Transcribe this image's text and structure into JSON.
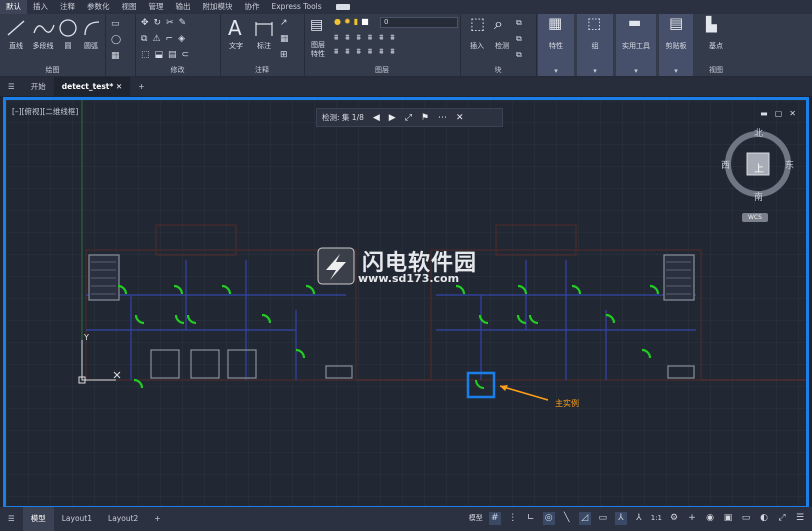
{
  "menu_tabs": [
    "默认",
    "插入",
    "注释",
    "参数化",
    "视图",
    "管理",
    "输出",
    "附加模块",
    "协作",
    "Express Tools"
  ],
  "ribbon": {
    "draw": {
      "label": "绘图",
      "tools": [
        "直线",
        "多段线",
        "圆",
        "圆弧"
      ]
    },
    "modify": {
      "label": "修改"
    },
    "annotation": {
      "label": "注释",
      "tools": [
        "文字",
        "标注"
      ]
    },
    "layers": {
      "label": "图层",
      "layer_properties": "图层\n特性",
      "current_layer": "0"
    },
    "block": {
      "label": "块",
      "tools": [
        "插入",
        "检测"
      ]
    },
    "properties": {
      "label": "特性"
    },
    "groups": {
      "label": "组"
    },
    "utilities": {
      "label": "实用工具"
    },
    "clipboard": {
      "label": "剪贴板"
    },
    "view": {
      "label": "视图",
      "base": "基点"
    }
  },
  "doc_tabs": {
    "start": "开始",
    "current": "detect_test*"
  },
  "viewport": {
    "label": "[–][俯视][二维线框]"
  },
  "detect_toolbar": {
    "text": "检测: 集 1/8"
  },
  "viewcube": {
    "north": "北",
    "south": "南",
    "east": "东",
    "west": "西",
    "top": "上",
    "wcs": "WCS"
  },
  "watermark": {
    "cn": "闪电软件园",
    "url": "www.sd173.com"
  },
  "annotation_label": "主实例",
  "status_bar": {
    "model_tab": "模型",
    "layouts": [
      "Layout1",
      "Layout2"
    ],
    "mode": "模型",
    "scale": "1:1"
  },
  "colors": {
    "accent": "#1a7fe8",
    "door": "#22cc22",
    "wall": "#3344aa",
    "annot": "#ff9f1a"
  }
}
